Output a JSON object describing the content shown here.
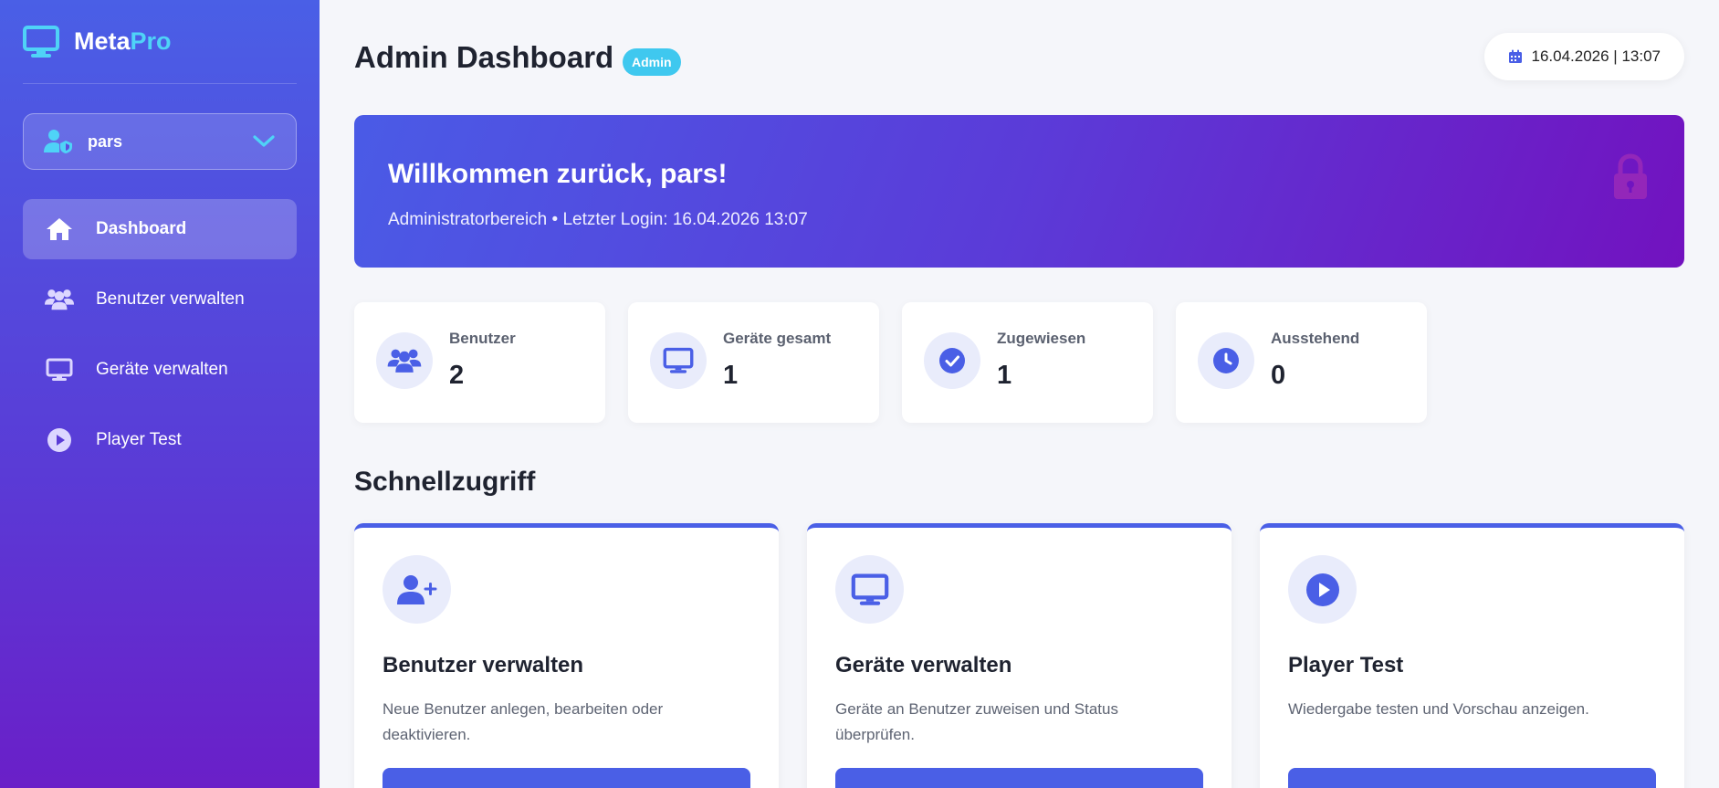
{
  "brand": {
    "name": "Meta",
    "accent": "Pro"
  },
  "user": {
    "name": "pars"
  },
  "nav": {
    "items": [
      {
        "label": "Dashboard",
        "icon": "home-icon",
        "active": true
      },
      {
        "label": "Benutzer verwalten",
        "icon": "users-icon",
        "active": false
      },
      {
        "label": "Geräte verwalten",
        "icon": "monitor-icon",
        "active": false
      },
      {
        "label": "Player Test",
        "icon": "play-icon",
        "active": false
      }
    ]
  },
  "header": {
    "title": "Admin Dashboard",
    "badge": "Admin",
    "datetime": "16.04.2026 | 13:07"
  },
  "welcome": {
    "title": "Willkommen zurück, pars!",
    "subtitle": "Administratorbereich • Letzter Login: 16.04.2026 13:07"
  },
  "stats": [
    {
      "label": "Benutzer",
      "value": "2",
      "icon": "users-icon"
    },
    {
      "label": "Geräte gesamt",
      "value": "1",
      "icon": "monitor-icon"
    },
    {
      "label": "Zugewiesen",
      "value": "1",
      "icon": "check-circle-icon"
    },
    {
      "label": "Ausstehend",
      "value": "0",
      "icon": "clock-icon"
    }
  ],
  "quick_access": {
    "title": "Schnellzugriff",
    "cards": [
      {
        "title": "Benutzer verwalten",
        "desc": "Neue Benutzer anlegen, bearbeiten oder deaktivieren.",
        "icon": "user-plus-icon"
      },
      {
        "title": "Geräte verwalten",
        "desc": "Geräte an Benutzer zuweisen und Status überprüfen.",
        "icon": "monitor-icon"
      },
      {
        "title": "Player Test",
        "desc": "Wiedergabe testen und Vorschau anzeigen.",
        "icon": "play-circle-icon"
      }
    ]
  },
  "colors": {
    "accent": "#4a5fe6",
    "cyan": "#4fd3f7",
    "badge": "#3fc8ef",
    "gradient_end": "#7212bf"
  }
}
